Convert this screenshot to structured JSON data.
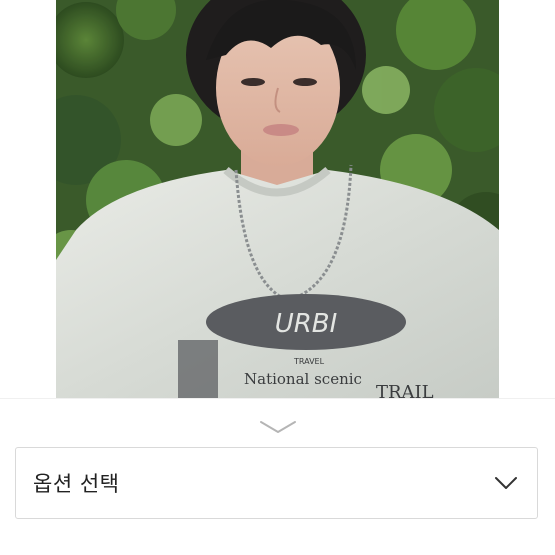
{
  "product_image": {
    "icon": "product-photo",
    "print": {
      "logo_text": "URBI",
      "line1": "TRAVEL",
      "line2": "National scenic",
      "line3": "TRAIL"
    }
  },
  "sheet": {
    "handle_icon": "chevron-down-icon"
  },
  "option_select": {
    "label": "옵션 선택",
    "icon": "chevron-down-icon"
  },
  "colors": {
    "border": "#d9d9d9",
    "text": "#222222",
    "handle": "#b5b5b5"
  }
}
